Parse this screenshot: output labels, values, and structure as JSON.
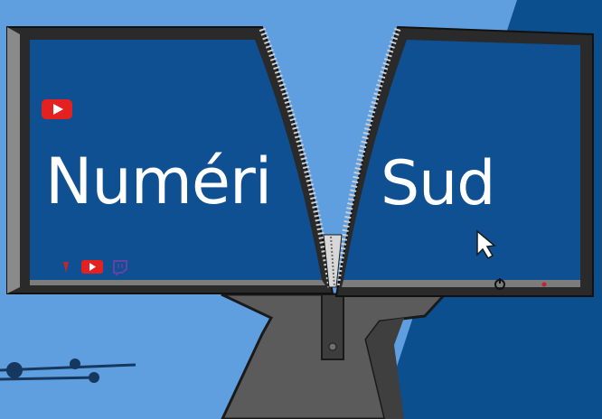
{
  "screen": {
    "left_word": "Numéri",
    "right_word": "Sud"
  },
  "colors": {
    "background_light": "#5f9fe0",
    "background_dark": "#0b4f8e",
    "screen_blue": "#0f5093",
    "bezel": "#2a2a2a",
    "bezel_edge": "#888888",
    "stand": "#5b5b5b",
    "youtube_red": "#e52020",
    "twitch_purple": "#6441a5"
  },
  "icons": {
    "top_left": "youtube-icon",
    "bottom_row": [
      "flag-icon",
      "youtube-icon",
      "twitch-icon"
    ],
    "cursor": "mouse-pointer-icon",
    "power": "power-button-icon",
    "led": "power-led-icon"
  }
}
